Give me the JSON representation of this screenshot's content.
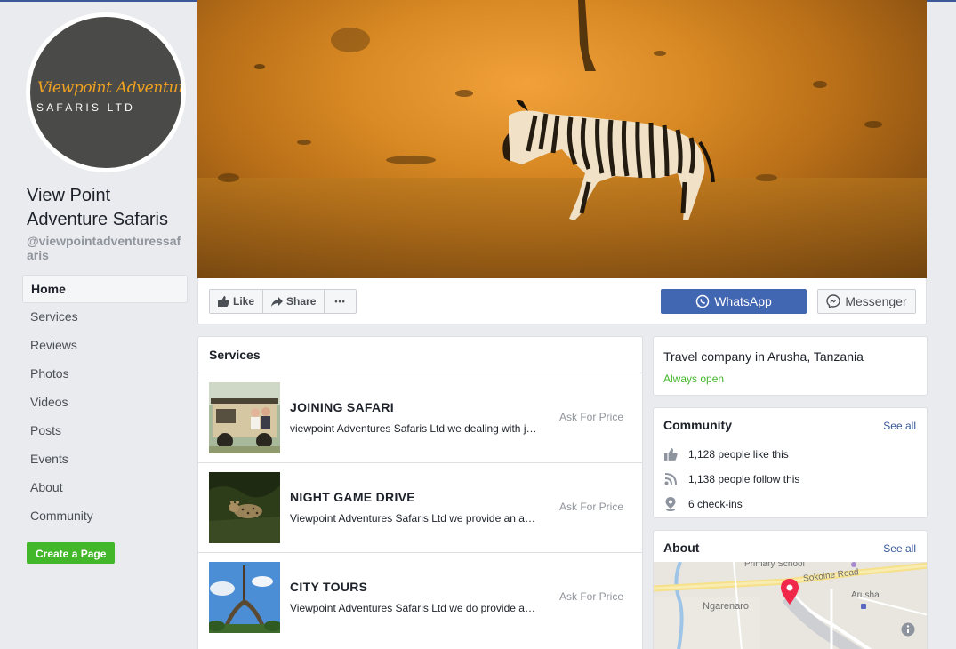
{
  "page": {
    "name": "View Point Adventure Safaris",
    "handle": "@viewpointadventuressafaris",
    "logo_line1": "Viewpoint Adventure",
    "logo_line2": "SAFARIS LTD"
  },
  "nav": {
    "items": [
      {
        "label": "Home",
        "active": true
      },
      {
        "label": "Services"
      },
      {
        "label": "Reviews"
      },
      {
        "label": "Photos"
      },
      {
        "label": "Videos"
      },
      {
        "label": "Posts"
      },
      {
        "label": "Events"
      },
      {
        "label": "About"
      },
      {
        "label": "Community"
      }
    ],
    "create_page": "Create a Page"
  },
  "actions": {
    "like": "Like",
    "share": "Share",
    "more": "•••",
    "whatsapp": "WhatsApp",
    "messenger": "Messenger"
  },
  "services": {
    "title": "Services",
    "items": [
      {
        "name": "JOINING SAFARI",
        "desc": "viewpoint Adventures Safaris Ltd we dealing with joining safari tours",
        "price": "Ask For Price"
      },
      {
        "name": "NIGHT GAME DRIVE",
        "desc": "Viewpoint Adventures Safaris Ltd we provide an amazing night game drive",
        "price": "Ask For Price"
      },
      {
        "name": "CITY TOURS",
        "desc": "Viewpoint Adventures Safaris Ltd we do provide a city tour in Arusha",
        "price": "Ask For Price"
      }
    ]
  },
  "info": {
    "description": "Travel company in Arusha, Tanzania",
    "hours": "Always open"
  },
  "community": {
    "title": "Community",
    "see_all": "See all",
    "likes": "1,128 people like this",
    "follows": "1,138 people follow this",
    "checkins": "6 check-ins"
  },
  "about": {
    "title": "About",
    "see_all": "See all",
    "map_labels": {
      "school": "Primary School",
      "road": "Sokoine Road",
      "arusha": "Arusha",
      "ngarenaro": "Ngarenaro"
    }
  },
  "colors": {
    "brand_blue": "#4267b2",
    "green": "#42b72a",
    "link": "#365899"
  }
}
